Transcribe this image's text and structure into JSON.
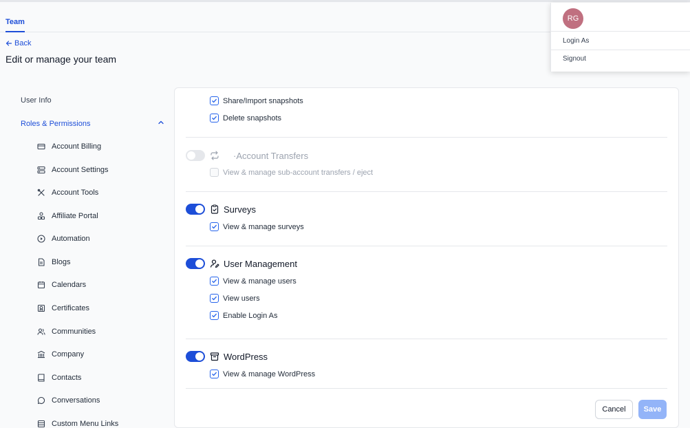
{
  "tabs": {
    "team": "Team"
  },
  "header": {
    "back": "Back",
    "title": "Edit or manage your team"
  },
  "nav": {
    "user_info": "User Info",
    "roles": "Roles & Permissions",
    "items": [
      {
        "label": "Account Billing",
        "icon": "credit-card-icon"
      },
      {
        "label": "Account Settings",
        "icon": "settings-icon"
      },
      {
        "label": "Account Tools",
        "icon": "tools-icon"
      },
      {
        "label": "Affiliate Portal",
        "icon": "affiliate-icon"
      },
      {
        "label": "Automation",
        "icon": "play-circle-icon"
      },
      {
        "label": "Blogs",
        "icon": "document-icon"
      },
      {
        "label": "Calendars",
        "icon": "calendar-icon"
      },
      {
        "label": "Certificates",
        "icon": "certificate-icon"
      },
      {
        "label": "Communities",
        "icon": "users-icon"
      },
      {
        "label": "Company",
        "icon": "building-icon"
      },
      {
        "label": "Contacts",
        "icon": "contact-book-icon"
      },
      {
        "label": "Conversations",
        "icon": "chat-bubble-icon"
      },
      {
        "label": "Custom Menu Links",
        "icon": "menu-link-icon"
      }
    ]
  },
  "permissions": {
    "snapshots": {
      "share_import": "Share/Import snapshots",
      "delete": "Delete snapshots"
    },
    "account_transfers": {
      "title": "·Account Transfers",
      "enabled": false,
      "manage": "View & manage sub-account transfers / eject"
    },
    "surveys": {
      "title": "Surveys",
      "enabled": true,
      "manage": "View & manage surveys"
    },
    "user_management": {
      "title": "User Management",
      "enabled": true,
      "manage": "View & manage users",
      "view": "View users",
      "login_as": "Enable Login As"
    },
    "wordpress": {
      "title": "WordPress",
      "enabled": true,
      "manage": "View & manage WordPress"
    }
  },
  "actions": {
    "cancel": "Cancel",
    "save": "Save"
  },
  "user_menu": {
    "initials": "RG",
    "login_as": "Login As",
    "signout": "Signout"
  },
  "colors": {
    "accent": "#1d4ed8",
    "avatar": "#c07080",
    "save_disabled": "#93b4f8"
  }
}
